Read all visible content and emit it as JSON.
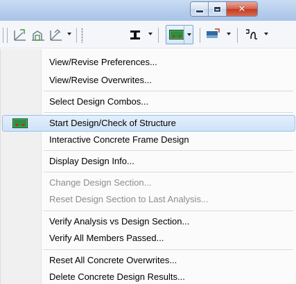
{
  "window": {
    "minimize_icon": "minimize-icon",
    "maximize_icon": "maximize-icon",
    "close_glyph": "✕"
  },
  "toolbar": {
    "icons": [
      "view-icon",
      "rotate-view-icon",
      "perspective-view-icon",
      "section-icon",
      "concrete-design-icon",
      "display-type-icon",
      "moment-diagram-icon"
    ]
  },
  "menu": {
    "items": [
      {
        "label": "View/Revise Preferences...",
        "disabled": false,
        "highlighted": false
      },
      {
        "label": "View/Revise Overwrites...",
        "disabled": false,
        "highlighted": false
      },
      {
        "label": "Select Design Combos...",
        "disabled": false,
        "highlighted": false
      },
      {
        "label": "Start Design/Check of Structure",
        "disabled": false,
        "highlighted": true,
        "icon": "design-check-icon"
      },
      {
        "label": "Interactive Concrete Frame Design",
        "disabled": false,
        "highlighted": false
      },
      {
        "label": "Display Design Info...",
        "disabled": false,
        "highlighted": false
      },
      {
        "label": "Change Design Section...",
        "disabled": true,
        "highlighted": false
      },
      {
        "label": "Reset Design Section to Last Analysis...",
        "disabled": true,
        "highlighted": false
      },
      {
        "label": "Verify Analysis vs Design Section...",
        "disabled": false,
        "highlighted": false
      },
      {
        "label": "Verify All Members Passed...",
        "disabled": false,
        "highlighted": false
      },
      {
        "label": "Reset All Concrete Overwrites...",
        "disabled": false,
        "highlighted": false
      },
      {
        "label": "Delete Concrete Design Results...",
        "disabled": false,
        "highlighted": false
      }
    ]
  },
  "colors": {
    "highlight": "#cfe2f8",
    "highlight_border": "#99c0ec",
    "disabled_text": "#8c8c8c",
    "titlebar": "#b9d0ee",
    "close_button": "#c43b23"
  }
}
